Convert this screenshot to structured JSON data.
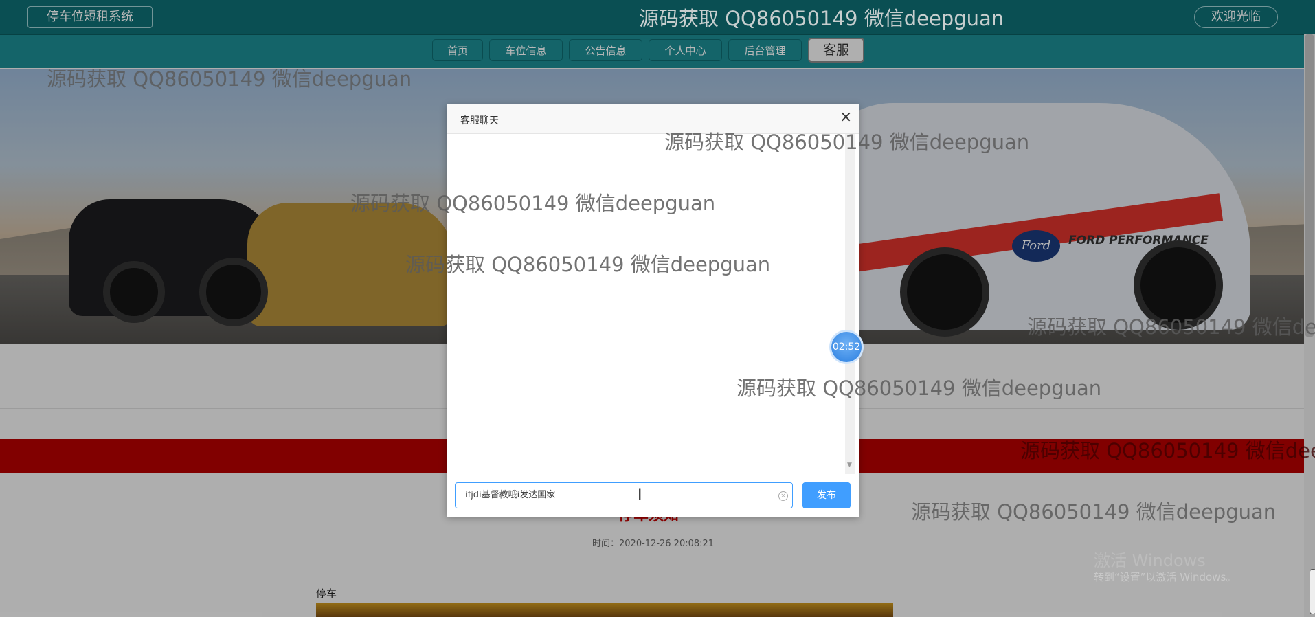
{
  "header": {
    "brand": "停车位短租系统",
    "welcome": "欢迎光临"
  },
  "nav": {
    "items": [
      {
        "label": "首页"
      },
      {
        "label": "车位信息"
      },
      {
        "label": "公告信息"
      },
      {
        "label": "个人中心"
      },
      {
        "label": "后台管理"
      },
      {
        "label": "客服"
      }
    ]
  },
  "banner": {
    "logo_text": "Ford",
    "brand_text": "FORD PERFORMANCE"
  },
  "article": {
    "title": "停车须知",
    "time": "时间：2020-12-26 20:08:21",
    "content_label": "停车"
  },
  "chat_dialog": {
    "title": "客服聊天",
    "close_symbol": "×",
    "input_value": "ifjdi基督教哦i发达国家",
    "send_label": "发布"
  },
  "timer": {
    "value": "02:52"
  },
  "watermark": {
    "text": "源码获取 QQ86050149 微信deepguan"
  },
  "windows": {
    "line1": "激活 Windows",
    "line2": "转到“设置”以激活 Windows。"
  },
  "colors": {
    "topbar": "#0f6e73",
    "navbar": "#1c8b92",
    "accent_blue": "#409eff",
    "red_bar": "#b30000"
  },
  "icons": {
    "close": "close-icon",
    "clear": "clear-circle-icon",
    "cursor": "text-cursor-icon"
  }
}
